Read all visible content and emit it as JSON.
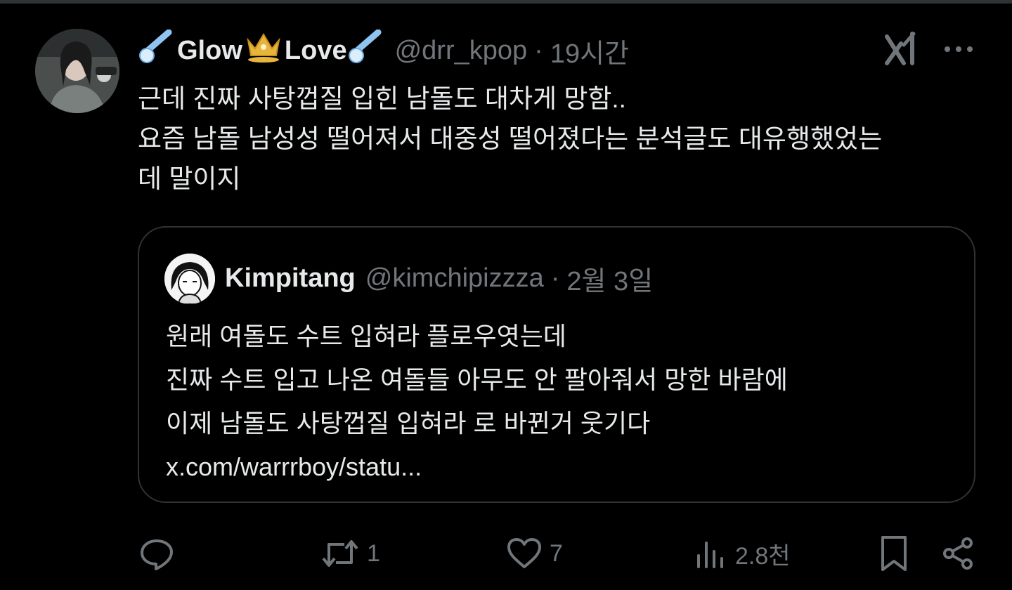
{
  "tweet": {
    "display_name_1": "Glow",
    "display_name_2": "Love",
    "handle": "@drr_kpop",
    "separator": "·",
    "time": "19시간",
    "text_lines": [
      "근데 진짜 사탕껍질 입힌 남돌도 대차게 망함..",
      "요즘 남돌 남성성 떨어져서 대중성 떨어졌다는 분석글도 대유행했었는",
      "데 말이지"
    ]
  },
  "quote": {
    "display_name": "Kimpitang",
    "handle": "@kimchipizzza",
    "separator": "·",
    "time": "2월 3일",
    "text_lines": [
      "원래 여돌도 수트 입혀라 플로우엿는데",
      "진짜 수트 입고 나온 여돌들 아무도 안 팔아줘서 망한 바람에",
      "이제 남돌도 사탕껍질 입혀라 로 바뀐거 웃기다",
      "x.com/warrrboy/statu..."
    ]
  },
  "actions": {
    "reply_count": "",
    "retweet_count": "1",
    "like_count": "7",
    "views_count": "2.8천"
  },
  "icons": [
    "comet-icon",
    "crown-icon",
    "xai-icon",
    "more-icon",
    "reply-icon",
    "retweet-icon",
    "like-icon",
    "views-icon",
    "bookmark-icon",
    "share-icon"
  ],
  "colors": {
    "background": "#000000",
    "text": "#e7e9ea",
    "secondary": "#71767b",
    "border": "#2f3336",
    "crown": "#e7b53c",
    "comet": "#8fc3f0"
  }
}
